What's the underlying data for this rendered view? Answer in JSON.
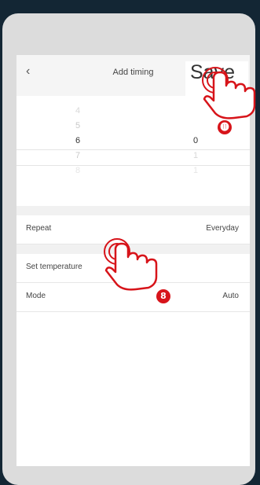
{
  "header": {
    "back_icon": "chevron-left-icon",
    "title": "Add timing",
    "save_label": "Save"
  },
  "picker": {
    "hours": [
      "4",
      "5",
      "6",
      "7",
      "8"
    ],
    "minutes": [
      "",
      "",
      "0",
      "1",
      "1"
    ]
  },
  "settings": {
    "repeat_label": "Repeat",
    "repeat_value": "Everyday",
    "temperature_label": "Set temperature",
    "mode_label": "Mode",
    "mode_value": "Auto"
  },
  "annotations": {
    "step_save": "⓫",
    "step_temperature": "8",
    "accent_color": "#d7141a"
  }
}
